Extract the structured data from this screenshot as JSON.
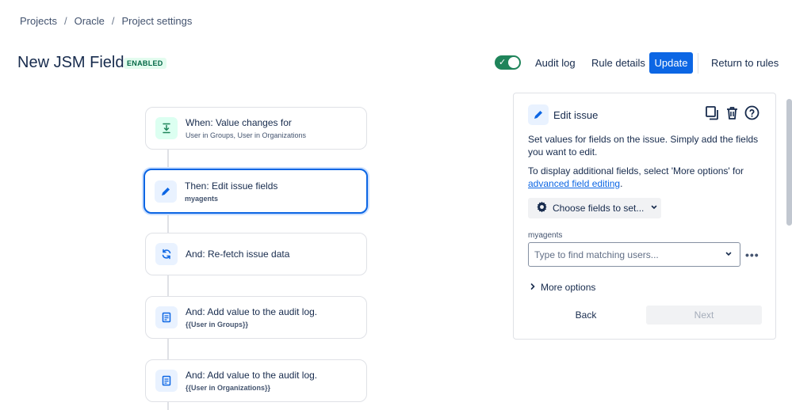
{
  "breadcrumb": [
    "Projects",
    "Oracle",
    "Project settings"
  ],
  "header": {
    "title": "New JSM Field",
    "status": "ENABLED",
    "enabled": true,
    "audit_log": "Audit log",
    "rule_details": "Rule details",
    "update": "Update",
    "return": "Return to rules"
  },
  "flow": [
    {
      "title": "When: Value changes for",
      "sub": "User in Groups, User in Organizations",
      "icon": "field-change-icon"
    },
    {
      "title": "Then: Edit issue fields",
      "sub": "myagents",
      "icon": "pencil-icon"
    },
    {
      "title": "And: Re-fetch issue data",
      "sub": "",
      "icon": "refresh-icon"
    },
    {
      "title": "And: Add value to the audit log.",
      "sub": "{{User in Groups}}",
      "icon": "audit-log-icon"
    },
    {
      "title": "And: Add value to the audit log.",
      "sub": "{{User in Organizations}}",
      "icon": "audit-log-icon"
    }
  ],
  "panel": {
    "title": "Edit issue",
    "desc1": "Set values for fields on the issue. Simply add the fields you want to edit.",
    "desc2_pre": "To display additional fields, select 'More options' for",
    "desc2_link": "advanced field editing",
    "desc2_post": ".",
    "choose_fields": "Choose fields to set...",
    "field_label": "myagents",
    "field_placeholder": "Type to find matching users...",
    "more_options": "More options",
    "back": "Back",
    "next": "Next"
  },
  "colors": {
    "primary": "#0c66e4",
    "toggle_on": "#1f845a",
    "enabled_badge": "#006644"
  }
}
